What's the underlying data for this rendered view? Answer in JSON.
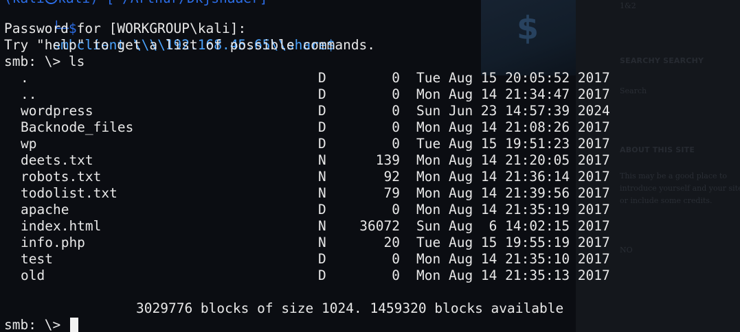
{
  "terminal": {
    "partial_top_line": "(kali㉿kali)-[~/Arthur/Dkjshaaer]",
    "prompt_command": {
      "corner": "└─$",
      "command": "smbclient \\\\\\\\192.168.45.65\\\\share$"
    },
    "password_prompt": "Password for [WORKGROUP\\kali]:",
    "help_hint": "Try \"help\" to get a list of possible commands.",
    "smb_prompt": "smb: \\> ",
    "ls_command": "ls",
    "listing": [
      {
        "name": ".",
        "type": "D",
        "size": "0",
        "date": "Tue Aug 15 20:05:52 2017"
      },
      {
        "name": "..",
        "type": "D",
        "size": "0",
        "date": "Mon Aug 14 21:34:47 2017"
      },
      {
        "name": "wordpress",
        "type": "D",
        "size": "0",
        "date": "Sun Jun 23 14:57:39 2024"
      },
      {
        "name": "Backnode_files",
        "type": "D",
        "size": "0",
        "date": "Mon Aug 14 21:08:26 2017"
      },
      {
        "name": "wp",
        "type": "D",
        "size": "0",
        "date": "Tue Aug 15 19:51:23 2017"
      },
      {
        "name": "deets.txt",
        "type": "N",
        "size": "139",
        "date": "Mon Aug 14 21:20:05 2017"
      },
      {
        "name": "robots.txt",
        "type": "N",
        "size": "92",
        "date": "Mon Aug 14 21:36:14 2017"
      },
      {
        "name": "todolist.txt",
        "type": "N",
        "size": "79",
        "date": "Mon Aug 14 21:39:56 2017"
      },
      {
        "name": "apache",
        "type": "D",
        "size": "0",
        "date": "Mon Aug 14 21:35:19 2017"
      },
      {
        "name": "index.html",
        "type": "N",
        "size": "36072",
        "date": "Sun Aug  6 14:02:15 2017"
      },
      {
        "name": "info.php",
        "type": "N",
        "size": "20",
        "date": "Tue Aug 15 19:55:19 2017"
      },
      {
        "name": "test",
        "type": "D",
        "size": "0",
        "date": "Mon Aug 14 21:35:10 2017"
      },
      {
        "name": "old",
        "type": "D",
        "size": "0",
        "date": "Mon Aug 14 21:35:13 2017"
      }
    ],
    "blocks_summary": "3029776 blocks of size 1024. 1459320 blocks available",
    "final_prompt": "smb: \\> "
  },
  "background_page": {
    "art_glyph": "$",
    "top_text": "1&2",
    "search_heading": "SEARCHY SEARCHY",
    "search_placeholder": "Search",
    "about_heading": "ABOUT THIS SITE",
    "about_text_1": "This may be a good place to",
    "about_text_2": "introduce yourself and your site",
    "about_text_3": "or include some credits.",
    "bottom_text": "NO"
  },
  "colors": {
    "background": "#0b0d12",
    "text": "#e8e8e8",
    "prompt_blue": "#2c6ee8",
    "command_blue": "#4aa3ff"
  }
}
